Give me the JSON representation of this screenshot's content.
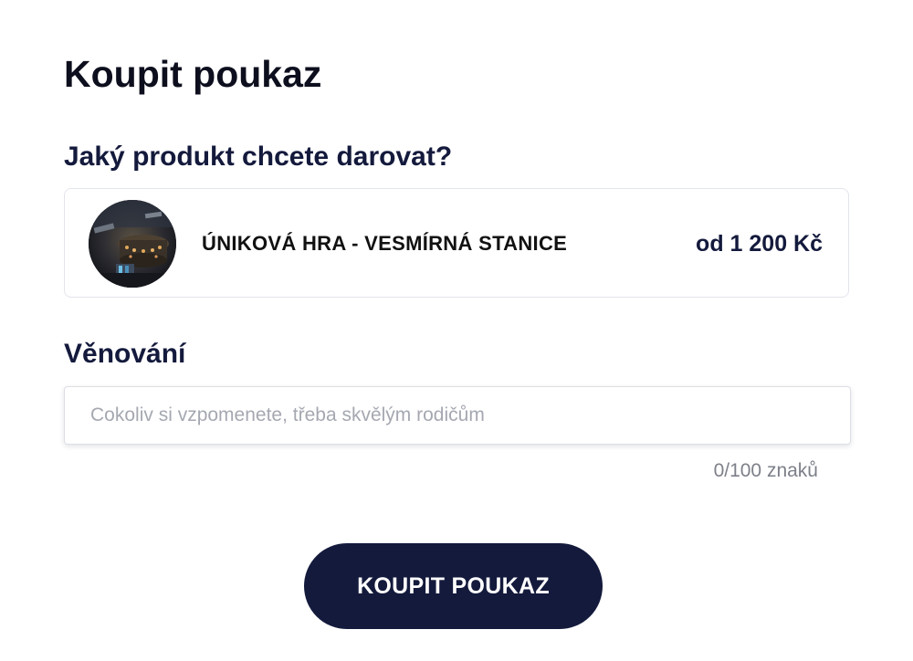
{
  "page": {
    "title": "Koupit poukaz"
  },
  "product_section": {
    "heading": "Jaký produkt chcete darovat?",
    "product": {
      "name": "ÚNIKOVÁ HRA - VESMÍRNÁ STANICE",
      "price": "od 1 200 Kč",
      "image_icon": "space-station-image"
    }
  },
  "dedication_section": {
    "heading": "Věnování",
    "input": {
      "value": "",
      "placeholder": "Cokoliv si vzpomenete, třeba skvělým rodičům"
    },
    "counter": "0/100 znaků"
  },
  "actions": {
    "buy_label": "KOUPIT POUKAZ"
  },
  "colors": {
    "navy": "#141a3c",
    "title": "#0d0f1e",
    "border": "#e3e5ec",
    "placeholder": "#a5a8b1",
    "counter": "#7d8089",
    "button_text": "#ffffff"
  }
}
